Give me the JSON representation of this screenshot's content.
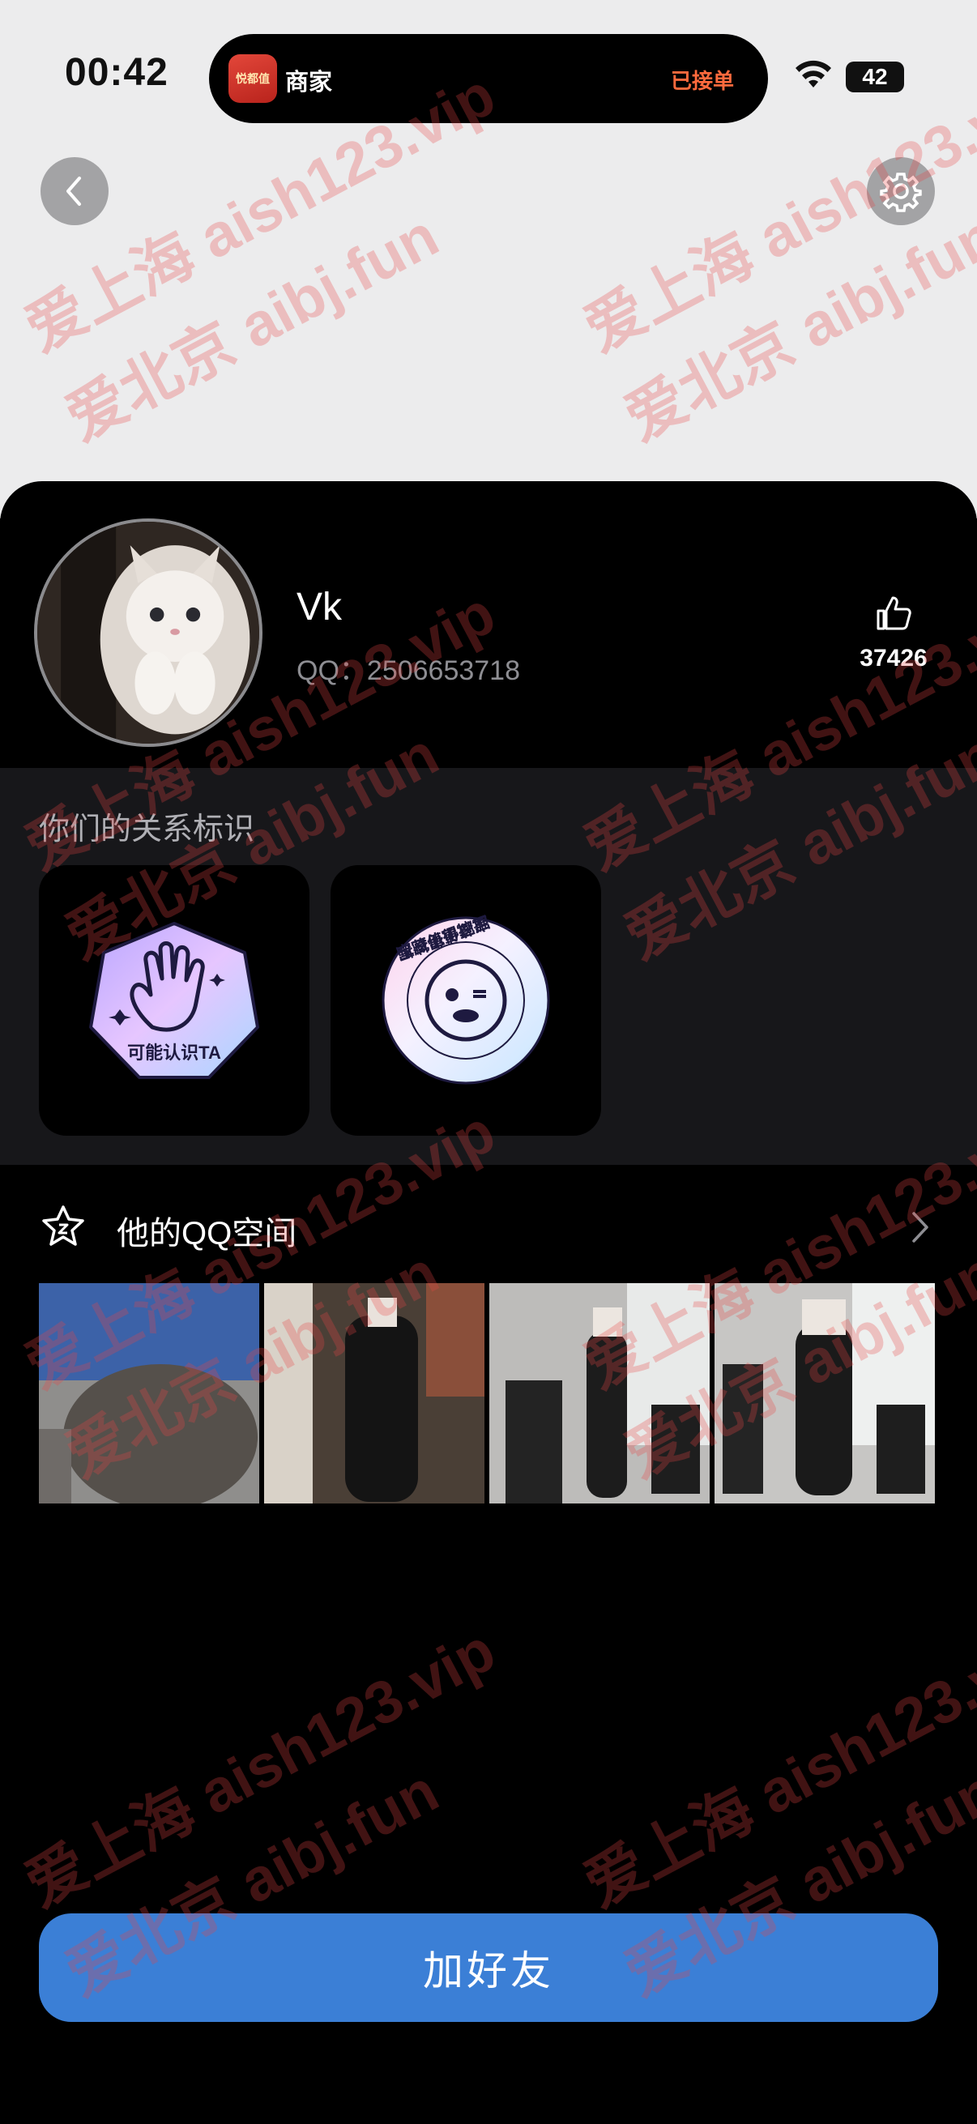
{
  "status_bar": {
    "time": "00:42",
    "battery": "42"
  },
  "island": {
    "app_icon_text": "悦都值",
    "title": "商家",
    "status": "已接单"
  },
  "icons": {
    "back": "chevron-left-icon",
    "settings": "gear-icon",
    "like": "thumbs-up-icon",
    "qzone": "star-icon",
    "more": "chevron-right-icon",
    "wifi": "wifi-icon"
  },
  "profile": {
    "name": "Vk",
    "qq_label": "QQ：",
    "qq_number": "2506653718",
    "like_count": "37426"
  },
  "relation": {
    "title": "你们的关系标识",
    "badges": [
      {
        "label": "可能认识TA"
      },
      {
        "label": "宝藏值得挖掘"
      }
    ]
  },
  "qzone": {
    "title": "他的QQ空间"
  },
  "action": {
    "add_friend_label": "加好友"
  },
  "watermark": {
    "line1": "爱上海 aish123.vip",
    "line2": "爱北京 aibj.fun"
  },
  "colors": {
    "accent_blue": "#3b7fd6",
    "island_status_orange": "#ff6a3d",
    "top_background": "#ececed",
    "card_background": "#000000",
    "section_background": "#17171a"
  }
}
